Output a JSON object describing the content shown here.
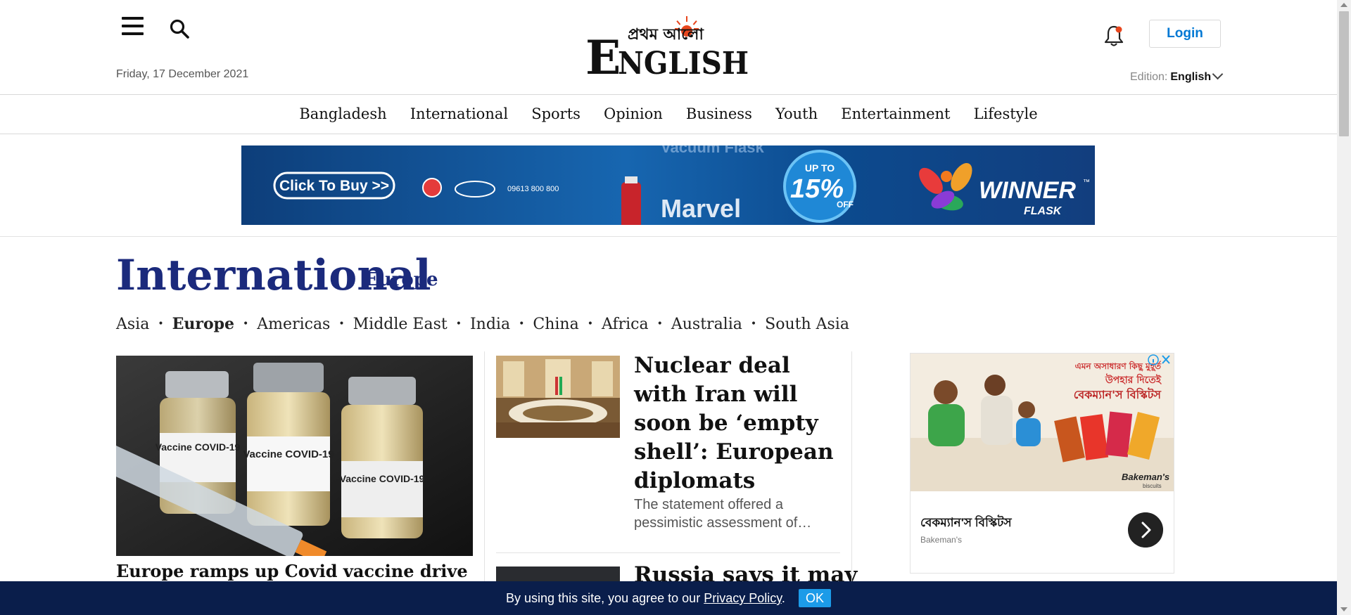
{
  "header": {
    "date": "Friday, 17 December 2021",
    "logo_main": "ENGLISH",
    "logo_bangla": "প্রথম আলো",
    "login_label": "Login",
    "edition_label": "Edition:",
    "edition_value": "English",
    "icons": [
      "menu-icon",
      "search-icon",
      "bell-icon",
      "chevron-down-icon"
    ],
    "accent_color": "#0078d4",
    "brand_color": "#1b2a7c"
  },
  "nav": {
    "items": [
      "Bangladesh",
      "International",
      "Sports",
      "Opinion",
      "Business",
      "Youth",
      "Entertainment",
      "Lifestyle"
    ]
  },
  "banner_ad": {
    "cta": "Click To Buy >>",
    "phone": "09613 800 800",
    "product": "Marvel",
    "product_top": "Vacuum Flask",
    "discount_top": "UP TO",
    "discount_value": "15%",
    "discount_bottom": "OFF",
    "brand": "WINNER",
    "brand_sub": "FLASK",
    "ms": "™"
  },
  "section": {
    "title": "International",
    "subtitle": "Europe",
    "subnav": [
      "Asia",
      "Europe",
      "Americas",
      "Middle East",
      "India",
      "China",
      "Africa",
      "Australia",
      "South Asia"
    ],
    "active_subnav": "Europe"
  },
  "lead_story": {
    "image_labels": [
      "Vaccine COVID-19",
      "Vaccine COVID-19",
      "Vaccine COVID-19"
    ],
    "title": "Europe ramps up Covid vaccine drive for"
  },
  "stories": [
    {
      "title": "Nuclear deal with Iran will soon be ‘empty shell’: European diplomats",
      "summary": "The statement offered a pessimistic assessment of…"
    },
    {
      "title": "Russia says it may"
    }
  ],
  "side_ad": {
    "title": "বেকম্যান'স বিস্কিটস",
    "brand": "Bakeman's",
    "headline_1": "এমন অসাধারণ কিছু মুহূর্ত",
    "headline_2": "উপহার দিতেই",
    "headline_3": "বেকম্যান'স বিস্কিটস",
    "pack_brand": "Bakeman's",
    "pack_sub": "biscuits"
  },
  "cookie": {
    "text_before": "By using this site, you agree to our",
    "link": "Privacy Policy",
    "text_after": ".",
    "ok_label": "OK"
  }
}
